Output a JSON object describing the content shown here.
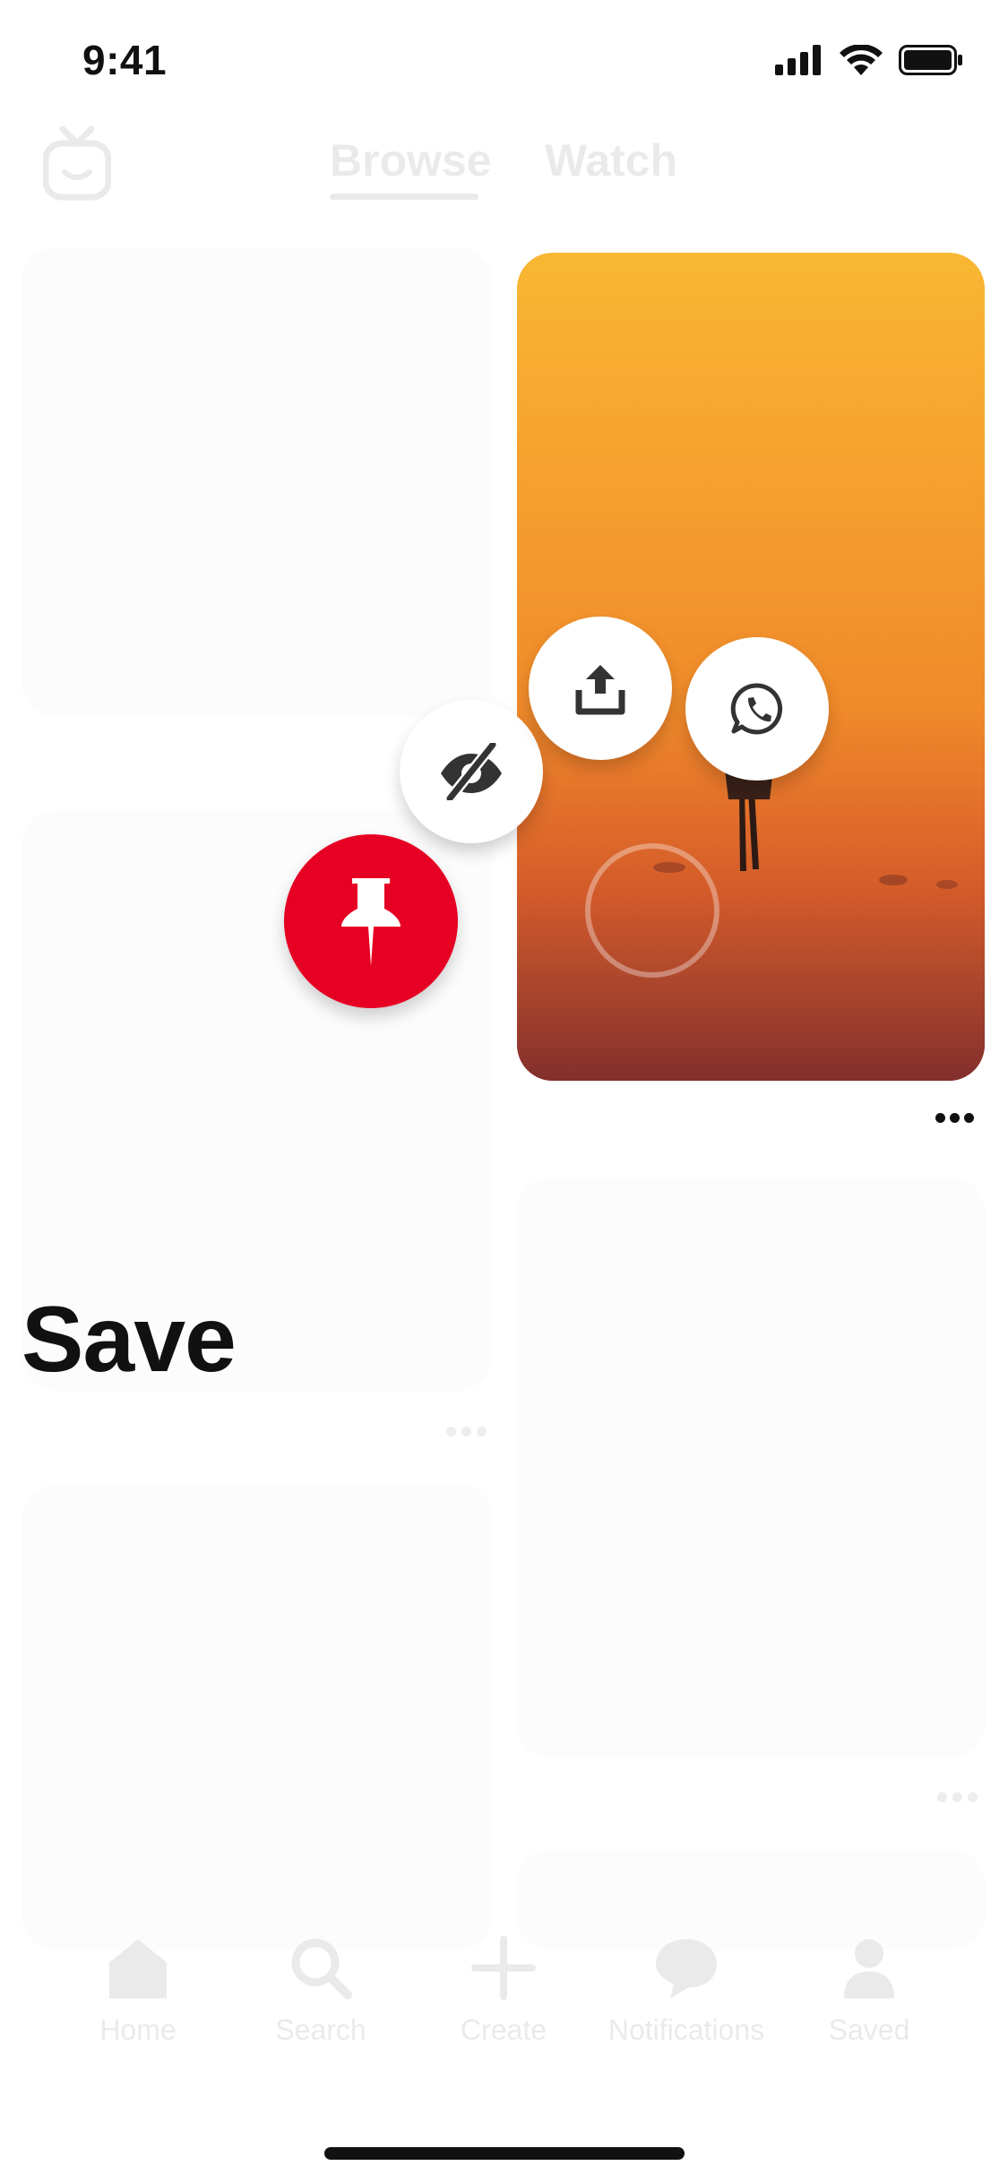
{
  "status_bar": {
    "time": "9:41"
  },
  "header": {
    "tabs": [
      {
        "label": "Browse",
        "active": true
      },
      {
        "label": "Watch",
        "active": false
      }
    ]
  },
  "overlay": {
    "action_label": "Save",
    "actions": [
      {
        "name": "save",
        "icon": "pin-icon",
        "color": "#e60023"
      },
      {
        "name": "hide",
        "icon": "eye-slash-icon"
      },
      {
        "name": "share",
        "icon": "share-upload-icon"
      },
      {
        "name": "whatsapp",
        "icon": "whatsapp-icon"
      }
    ]
  },
  "tab_bar": {
    "items": [
      {
        "label": "Home",
        "icon": "home-icon"
      },
      {
        "label": "Search",
        "icon": "search-icon"
      },
      {
        "label": "Create",
        "icon": "plus-icon"
      },
      {
        "label": "Notifications",
        "icon": "chat-bubble-icon"
      },
      {
        "label": "Saved",
        "icon": "person-icon"
      }
    ]
  },
  "colors": {
    "accent": "#e60023",
    "pin_gradient_top": "#f8b733",
    "pin_gradient_bottom": "#8e3430"
  }
}
